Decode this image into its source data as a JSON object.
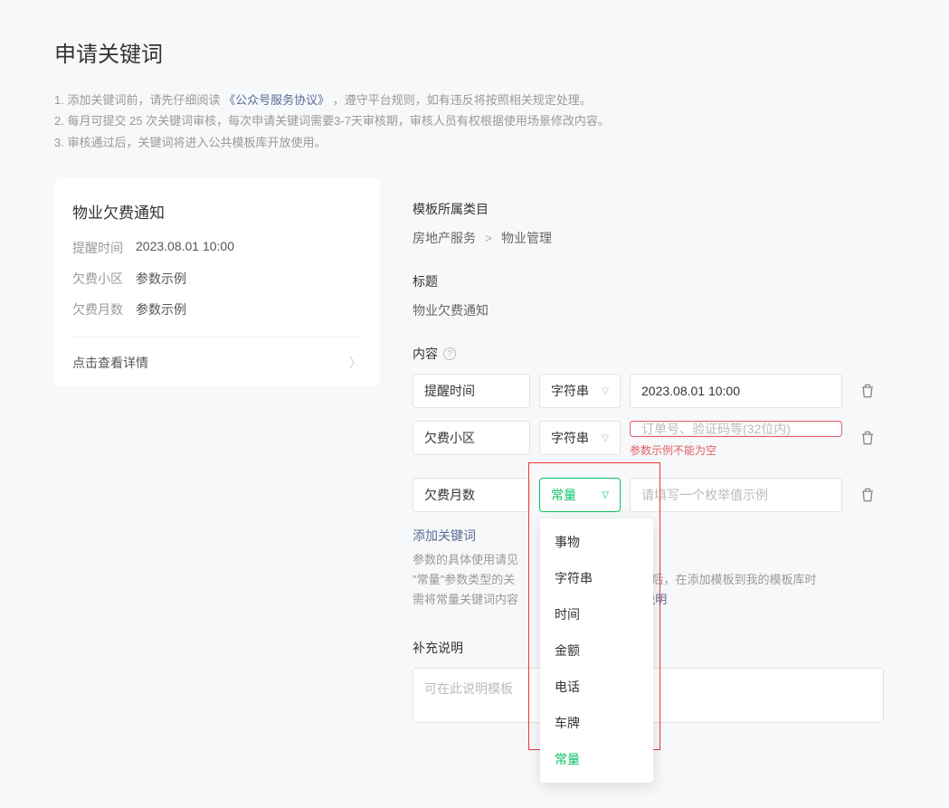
{
  "page_title": "申请关键词",
  "instructions": {
    "line1_prefix": "1. 添加关键词前，请先仔细阅读",
    "line1_link": "《公众号服务协议》",
    "line1_suffix": "，遵守平台规则，如有违反将按照相关规定处理。",
    "line2": "2. 每月可提交 25 次关键词审核，每次申请关键词需要3-7天审核期，审核人员有权根据使用场景修改内容。",
    "line3": "3. 审核通过后，关键词将进入公共模板库开放使用。"
  },
  "preview": {
    "title": "物业欠费通知",
    "rows": [
      {
        "label": "提醒时间",
        "value": "2023.08.01 10:00"
      },
      {
        "label": "欠费小区",
        "value": "参数示例"
      },
      {
        "label": "欠费月数",
        "value": "参数示例"
      }
    ],
    "detail_link": "点击查看详情"
  },
  "form": {
    "category_label": "模板所属类目",
    "category_path": [
      "房地产服务",
      "物业管理"
    ],
    "title_label": "标题",
    "title_value": "物业欠费通知",
    "content_label": "内容",
    "rows": [
      {
        "keyword": "提醒时间",
        "type": "字符串",
        "example": "2023.08.01 10:00",
        "placeholder": ""
      },
      {
        "keyword": "欠费小区",
        "type": "字符串",
        "example": "",
        "placeholder": "订单号、验证码等(32位内)",
        "error": "参数示例不能为空"
      },
      {
        "keyword": "欠费月数",
        "type": "常量",
        "example": "",
        "placeholder": "请填写一个枚举值示例"
      }
    ],
    "add_keyword": "添加关键词",
    "help_prefix": "参数的具体使用请见",
    "help_const_line1": "\"常量\"参数类型的关",
    "help_const_line1_suffix": "审核通过后，在添加模板到我的模板库时",
    "help_const_line2": "需将常量关键词内容",
    "help_detail_link": "看详细说明",
    "supplement_label": "补充说明",
    "supplement_placeholder": "可在此说明模板"
  },
  "dropdown_options": [
    "事物",
    "字符串",
    "时间",
    "金额",
    "电话",
    "车牌",
    "常量"
  ],
  "dropdown_selected": "常量"
}
